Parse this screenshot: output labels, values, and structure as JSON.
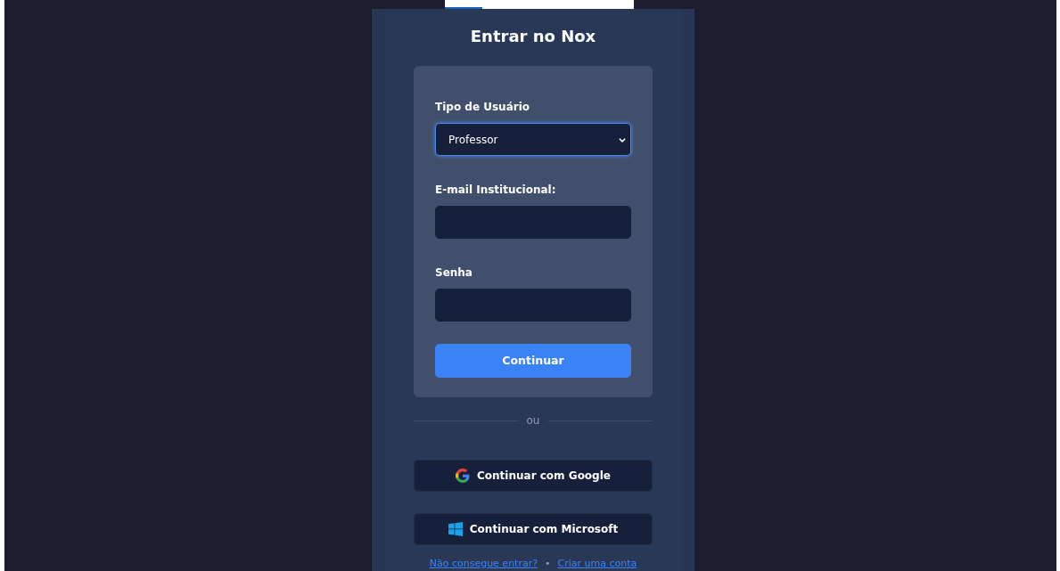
{
  "top_bar": {
    "level": 0.2
  },
  "title": "Entrar no Nox",
  "form": {
    "fields": [
      {
        "kind": "select",
        "label": "Tipo de Usuário",
        "value": "Professor",
        "focused": true
      },
      {
        "kind": "input",
        "label": "E-mail Institucional:",
        "focused": false
      },
      {
        "kind": "password",
        "label": "Senha",
        "focused": false
      }
    ],
    "submit": "Continuar"
  },
  "divider": "ou",
  "social_buttons": [
    {
      "kind": "google",
      "label": "Continuar com Google"
    },
    {
      "kind": "microsoft",
      "label": "Continuar com Microsoft"
    }
  ],
  "links": [
    "Não consegue entrar?",
    "Criar uma conta"
  ],
  "link_separator": "•"
}
